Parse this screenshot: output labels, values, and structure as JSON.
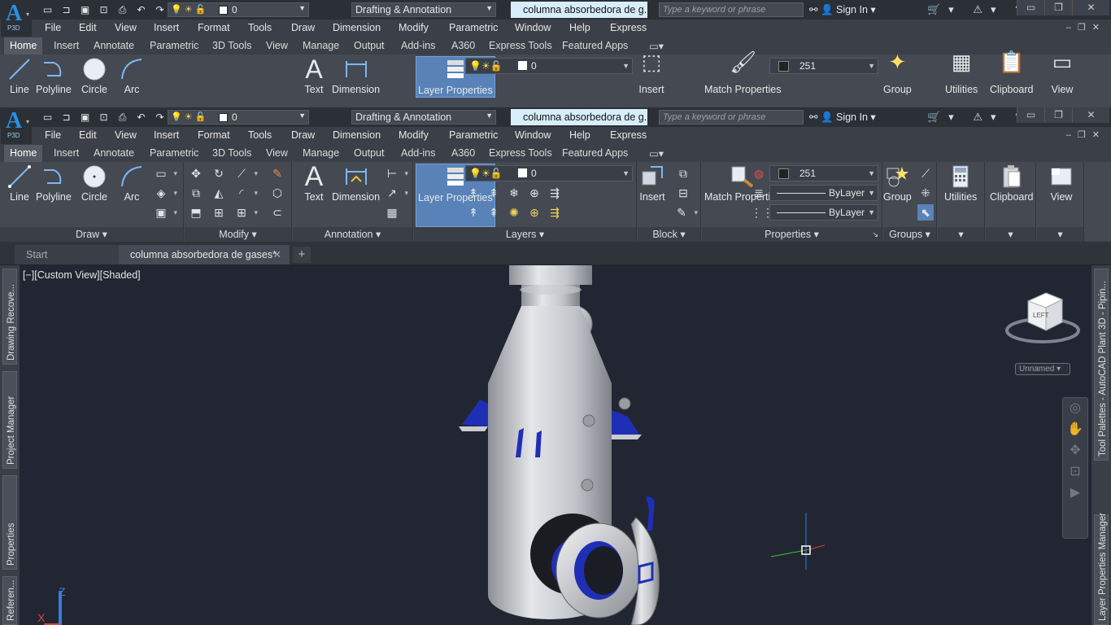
{
  "app": {
    "logo_letter": "A",
    "logo_sub": "P3D",
    "qat_icons": [
      "new-icon",
      "open-icon",
      "save-icon",
      "saveas-icon",
      "print-icon",
      "undo-icon",
      "redo-icon"
    ],
    "layer_value": "0",
    "workspace": "Drafting & Annotation",
    "document_title": "columna absorbedora de g...",
    "search_placeholder": "Type a keyword or phrase",
    "signin": "Sign In",
    "win_min": "▭",
    "win_max": "❐",
    "win_close": "✕"
  },
  "menu": [
    "File",
    "Edit",
    "View",
    "Insert",
    "Format",
    "Tools",
    "Draw",
    "Dimension",
    "Modify",
    "Parametric",
    "Window",
    "Help",
    "Express"
  ],
  "tabs": [
    "Home",
    "Insert",
    "Annotate",
    "Parametric",
    "3D Tools",
    "View",
    "Manage",
    "Output",
    "Add-ins",
    "A360",
    "Express Tools",
    "Featured Apps"
  ],
  "ribbon": {
    "draw": {
      "label": "Draw",
      "buttons": [
        "Line",
        "Polyline",
        "Circle",
        "Arc"
      ]
    },
    "modify": {
      "label": "Modify"
    },
    "annotation": {
      "label": "Annotation",
      "buttons": [
        "Text",
        "Dimension"
      ]
    },
    "layers": {
      "label": "Layers",
      "layer_properties": "Layer Properties",
      "layer_value": "0"
    },
    "block": {
      "label": "Block",
      "insert": "Insert"
    },
    "properties": {
      "label": "Properties",
      "match": "Match Properties",
      "color": "251",
      "linetype": "ByLayer",
      "lineweight": "ByLayer"
    },
    "groups": {
      "label": "Groups",
      "group": "Group"
    },
    "utilities": "Utilities",
    "clipboard": "Clipboard",
    "view": "View"
  },
  "doc_tabs": {
    "start": "Start",
    "current": "columna absorbedora de gases*",
    "close": "✕",
    "new": "+"
  },
  "viewport": {
    "label": "[−][Custom View][Shaded]",
    "viewcube_face": "LEFT",
    "view_name": "Unnamed",
    "ucs_z": "Z",
    "ucs_x": "X"
  },
  "palettes": {
    "left": [
      "Drawing Recove...",
      "Project Manager",
      "Properties",
      "Referen..."
    ],
    "right": [
      "Tool Palettes - AutoCAD Plant 3D - Pipin...",
      "Layer Properties Manager"
    ]
  }
}
